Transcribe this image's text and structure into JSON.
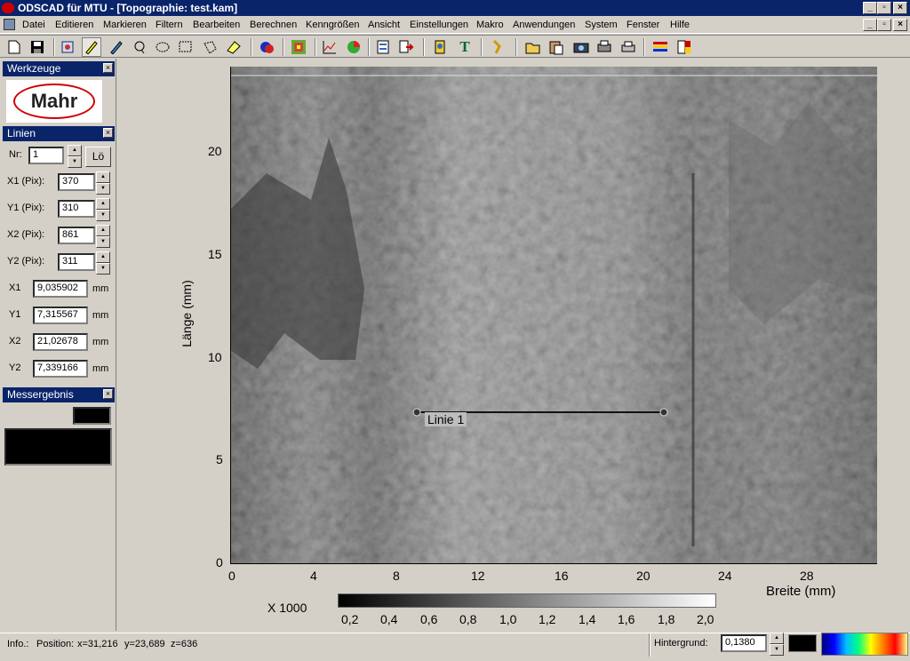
{
  "window": {
    "title": "ODSCAD für MTU - [Topographie:  test.kam]"
  },
  "menu": [
    "Datei",
    "Editieren",
    "Markieren",
    "Filtern",
    "Bearbeiten",
    "Berechnen",
    "Kenngrößen",
    "Ansicht",
    "Einstellungen",
    "Makro",
    "Anwendungen",
    "System",
    "Fenster",
    "Hilfe"
  ],
  "toolbar": [
    "new-icon",
    "save-icon",
    "edit-icon",
    "pen-icon",
    "marker-icon",
    "lasso-icon",
    "ellipse-select-icon",
    "rect-select-icon",
    "polygon-select-icon",
    "eraser-icon",
    "color-icon",
    "grid-icon",
    "chart-icon",
    "diagram-icon",
    "report-icon",
    "export-icon",
    "probe-icon",
    "text-icon",
    "measure-icon",
    "open-icon",
    "paste-icon",
    "camera-icon",
    "print-preview-icon",
    "print-icon",
    "palette-icon",
    "scale-icon"
  ],
  "panels": {
    "werkzeuge": {
      "title": "Werkzeuge",
      "logo": "Mahr"
    },
    "linien": {
      "title": "Linien",
      "nr_label": "Nr:",
      "nr_value": "1",
      "delete_label": "Lö",
      "pix_fields": [
        {
          "label": "X1 (Pix):",
          "value": "370"
        },
        {
          "label": "Y1 (Pix):",
          "value": "310"
        },
        {
          "label": "X2 (Pix):",
          "value": "861"
        },
        {
          "label": "Y2 (Pix):",
          "value": "311"
        }
      ],
      "mm_fields": [
        {
          "label": "X1",
          "value": "9,035902",
          "unit": "mm"
        },
        {
          "label": "Y1",
          "value": "7,315567",
          "unit": "mm"
        },
        {
          "label": "X2",
          "value": "21,02678",
          "unit": "mm"
        },
        {
          "label": "Y2",
          "value": "7,339166",
          "unit": "mm"
        }
      ]
    },
    "messergebnis": {
      "title": "Messergebnis"
    }
  },
  "plot": {
    "y_label": "Länge  (mm)",
    "x_label": "Breite  (mm)",
    "y_ticks": [
      "20",
      "15",
      "10",
      "5",
      "0"
    ],
    "x_ticks": [
      "0",
      "4",
      "8",
      "12",
      "16",
      "20",
      "24",
      "28"
    ],
    "line_label": "Linie 1",
    "colorbar_multiplier": "X 1000",
    "colorbar_ticks": [
      "0,2",
      "0,4",
      "0,6",
      "0,8",
      "1,0",
      "1,2",
      "1,4",
      "1,6",
      "1,8",
      "2,0"
    ]
  },
  "status": {
    "info_label": "Info.:",
    "position_label": "Position:",
    "x": "x=31,216",
    "y": "y=23,689",
    "z": "z=636",
    "hintergrund_label": "Hintergrund:",
    "hintergrund_value": "0,1380"
  }
}
